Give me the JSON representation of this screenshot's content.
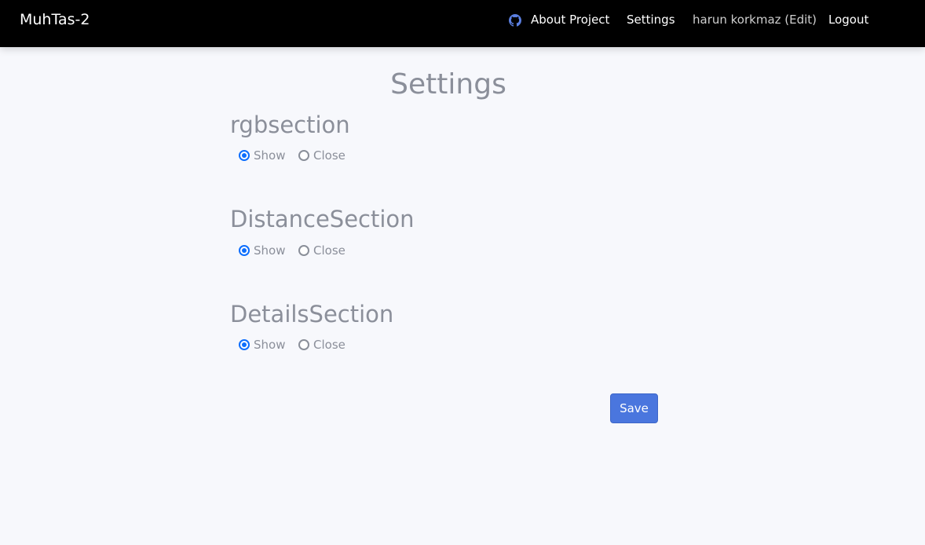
{
  "navbar": {
    "brand": "MuhTas-2",
    "about_project": "About Project",
    "settings": "Settings",
    "user": "harun korkmaz (Edit)",
    "logout": "Logout",
    "github_icon": "github-icon"
  },
  "page": {
    "title": "Settings"
  },
  "sections": [
    {
      "title": "rgbsection",
      "options": [
        "Show",
        "Close"
      ],
      "selected": "Show"
    },
    {
      "title": "DistanceSection",
      "options": [
        "Show",
        "Close"
      ],
      "selected": "Show"
    },
    {
      "title": "DetailsSection",
      "options": [
        "Show",
        "Close"
      ],
      "selected": "Show"
    }
  ],
  "actions": {
    "save": "Save"
  },
  "colors": {
    "navbar_bg": "#000000",
    "accent": "#0d6efd",
    "button": "#4a76de",
    "text_muted": "#8b8f9a",
    "page_bg": "#f7f8fc"
  }
}
